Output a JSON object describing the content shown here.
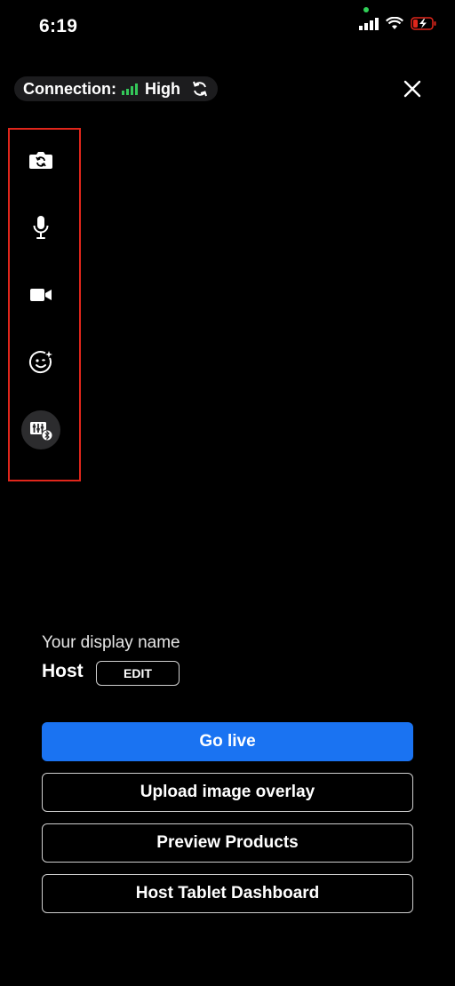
{
  "status_bar": {
    "time": "6:19"
  },
  "connection": {
    "label": "Connection:",
    "quality": "High",
    "bars_color": "#34c759"
  },
  "toolbar": {
    "items": [
      {
        "icon": "flip-camera-icon"
      },
      {
        "icon": "microphone-icon"
      },
      {
        "icon": "video-camera-icon"
      },
      {
        "icon": "face-effects-icon"
      },
      {
        "icon": "bluetooth-controller-icon"
      }
    ],
    "highlight_color": "#e0261b"
  },
  "display_name": {
    "label": "Your display name",
    "value": "Host",
    "edit_label": "EDIT"
  },
  "buttons": {
    "go_live": "Go live",
    "upload_overlay": "Upload image overlay",
    "preview_products": "Preview Products",
    "host_tablet": "Host Tablet Dashboard"
  },
  "colors": {
    "primary": "#1a73f2",
    "background": "#000000"
  }
}
